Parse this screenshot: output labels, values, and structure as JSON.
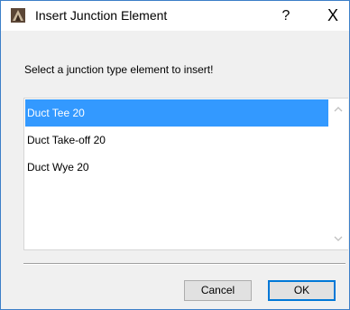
{
  "window": {
    "title": "Insert Junction Element",
    "help_label": "?",
    "close_label": "X",
    "app_icon": "archicad-app-icon"
  },
  "prompt": "Select a junction type element to insert!",
  "list": {
    "items": [
      "Duct Tee 20",
      "Duct Take-off 20",
      "Duct Wye 20"
    ],
    "selected_index": 0
  },
  "buttons": {
    "cancel_label": "Cancel",
    "ok_label": "OK"
  },
  "colors": {
    "selection": "#3399ff",
    "border_accent": "#3c7fc8",
    "default_button_border": "#0078d7"
  }
}
